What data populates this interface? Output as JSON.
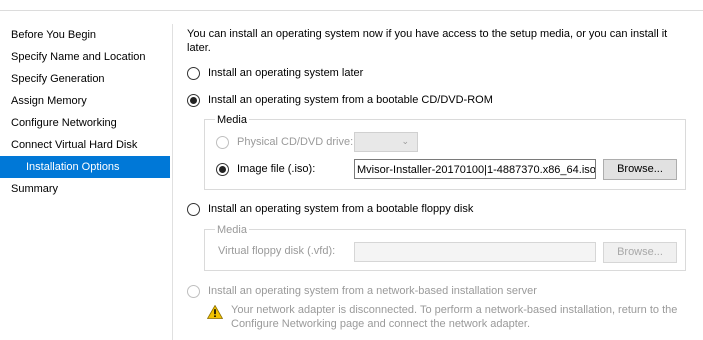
{
  "sidebar": {
    "items": [
      {
        "label": "Before You Begin"
      },
      {
        "label": "Specify Name and Location"
      },
      {
        "label": "Specify Generation"
      },
      {
        "label": "Assign Memory"
      },
      {
        "label": "Configure Networking"
      },
      {
        "label": "Connect Virtual Hard Disk"
      },
      {
        "label": "Installation Options"
      },
      {
        "label": "Summary"
      }
    ],
    "active_index": 6
  },
  "main": {
    "intro": "You can install an operating system now if you have access to the setup media, or you can install it later.",
    "option_later": "Install an operating system later",
    "option_cd": "Install an operating system from a bootable CD/DVD-ROM",
    "media_group_title": "Media",
    "physical_drive_label": "Physical CD/DVD drive:",
    "image_file_label": "Image file (.iso):",
    "image_file_value": "Mvisor-Installer-20170100|1-4887370.x86_64.iso",
    "browse_label": "Browse...",
    "option_floppy": "Install an operating system from a bootable floppy disk",
    "floppy_group_title": "Media",
    "virtual_floppy_label": "Virtual floppy disk (.vfd):",
    "floppy_browse_label": "Browse...",
    "option_network": "Install an operating system from a network-based installation server",
    "network_warning": "Your network adapter is disconnected. To perform a network-based installation, return to the Configure Networking page and connect the network adapter."
  },
  "colors": {
    "selection": "#0078d7",
    "disabled_text": "#9a9a9a",
    "warning": "#f2c200"
  },
  "icons": [
    "radio-selected",
    "radio-empty",
    "chevron-down-icon",
    "warning-icon"
  ]
}
